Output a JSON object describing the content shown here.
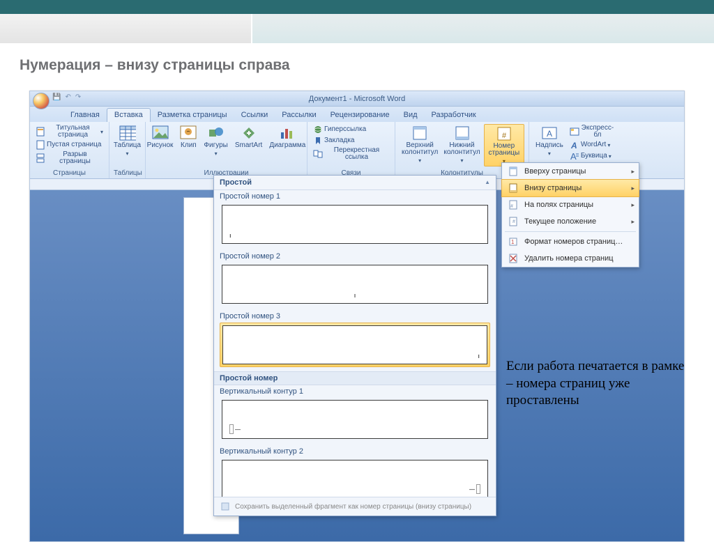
{
  "slide": {
    "title": "Нумерация – внизу страницы справа",
    "caption": "Если работа печатается в рамке – номера страниц уже проставлены"
  },
  "window": {
    "title": "Документ1 - Microsoft Word"
  },
  "tabs": {
    "t0": "Главная",
    "t1": "Вставка",
    "t2": "Разметка страницы",
    "t3": "Ссылки",
    "t4": "Рассылки",
    "t5": "Рецензирование",
    "t6": "Вид",
    "t7": "Разработчик"
  },
  "ribbon": {
    "pages": {
      "label": "Страницы",
      "title_page": "Титульная страница",
      "blank_page": "Пустая страница",
      "page_break": "Разрыв страницы"
    },
    "tables": {
      "label": "Таблицы",
      "table": "Таблица"
    },
    "illustrations": {
      "label": "Иллюстрации",
      "picture": "Рисунок",
      "clip": "Клип",
      "shapes": "Фигуры",
      "smartart": "SmartArt",
      "chart": "Диаграмма"
    },
    "links": {
      "label": "Связи",
      "hyperlink": "Гиперссылка",
      "bookmark": "Закладка",
      "crossref": "Перекрестная ссылка"
    },
    "headerfooter": {
      "label": "Колонтитулы",
      "header": "Верхний колонтитул",
      "footer": "Нижний колонтитул",
      "pagenum": "Номер страницы"
    },
    "text": {
      "textbox": "Надпись",
      "quickparts": "Экспресс-бл",
      "wordart": "WordArt",
      "dropcap": "Буквица"
    }
  },
  "submenu": {
    "top": "Вверху страницы",
    "bottom": "Внизу страницы",
    "margins": "На полях страницы",
    "current": "Текущее положение",
    "format": "Формат номеров страниц…",
    "remove": "Удалить номера страниц"
  },
  "gallery": {
    "header": "Простой",
    "n1": "Простой номер 1",
    "n2": "Простой номер 2",
    "n3": "Простой номер 3",
    "section2": "Простой номер",
    "v1": "Вертикальный контур 1",
    "v2": "Вертикальный контур 2",
    "save": "Сохранить выделенный фрагмент как номер страницы (внизу страницы)"
  }
}
